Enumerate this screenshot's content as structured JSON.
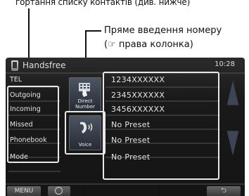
{
  "top_text": "гортання списку контактів (див. нижче)",
  "callout": {
    "line1": "Пряме введення номеру",
    "line2": "(☞ права колонка)"
  },
  "screen": {
    "title": "Handsfree",
    "clock": "10:28",
    "side_menu": [
      {
        "label": "TEL"
      },
      {
        "label": "Outgoing"
      },
      {
        "label": "Incoming"
      },
      {
        "label": "Missed"
      },
      {
        "label": "Phonebook"
      },
      {
        "label": "Mode"
      }
    ],
    "direct_number_label_line1": "Direct",
    "direct_number_label_line2": "Number",
    "voice_label": "Voice",
    "presets": [
      "1234XXXXXX",
      "2345XXXXXX",
      "3456XXXXXX",
      "No Preset",
      "No Preset",
      "No Preset"
    ],
    "menu_label": "MENU",
    "back_glyph": "⮌"
  }
}
